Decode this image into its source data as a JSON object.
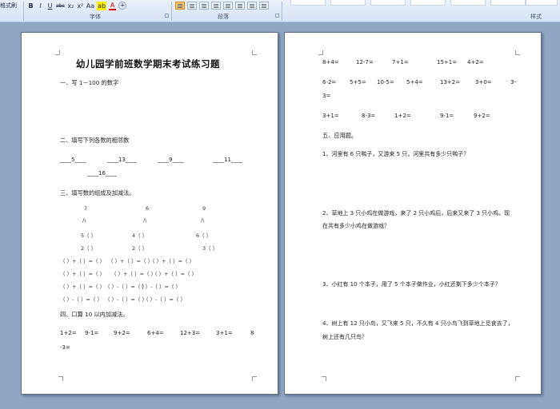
{
  "ribbon": {
    "left_stub": "格式刷",
    "font_buttons": [
      "B",
      "I",
      "U",
      "abc",
      "x₂",
      "x²",
      "Aa"
    ],
    "highlight_label": "ab",
    "font_color_label": "A",
    "font_group_label": "字体",
    "paragraph_group_label": "段落",
    "styles_group_label": "样式",
    "colors": {
      "highlight": "#ffef00",
      "font_color": "#cc0000",
      "active_align": "#f7c46a"
    }
  },
  "page1": {
    "title": "幼儿园学前班数学期末考试练习题",
    "sections": {
      "s1": "一、写 1－100 的数字",
      "s2": "二、填写下列各数的相邻数",
      "s3": "三、填写数的组成及加减法。",
      "s4": "四、口算 10 以内加减法。"
    },
    "neighbors": [
      "____5____",
      "____13____",
      "____9____",
      "____11____",
      "____16____"
    ],
    "composition": {
      "tops": [
        "7",
        "6",
        "9"
      ],
      "branches": [
        "/\\",
        "/\\",
        "/\\"
      ],
      "row1": [
        "5（  ）",
        "4（  ）",
        "6（    ）"
      ],
      "row2": [
        "2（  ）",
        "2（  ）",
        "3（    ）"
      ]
    },
    "equations": [
      [
        "（   ）+（ ）=（ ）",
        "（ ）+（ ）=（ ）",
        "（ ）+（ ）=（ ）"
      ],
      [
        "（ ）+（ ）=（      ）",
        "（ ）+（ ）=（ ）",
        "（ ）+（ ）=（ ）"
      ],
      [
        "（ ）+（ ）=（    ）",
        "（ ）-（ ）=（ ）",
        "（ ）-（ ）=（ ）"
      ],
      [
        "（ ）-（ ）=（ ）",
        "（ ）-（ ）=（ ）",
        "（ ）-（ ）=（ ）"
      ]
    ],
    "mental_math": [
      "1+2=",
      "9-1=",
      "9+2=",
      "6+4=",
      "12+3=",
      "3+1=",
      "8"
    ],
    "mental_math_wrap": "-3="
  },
  "page2": {
    "arithmetic": {
      "row1": [
        "8+4=",
        "12-7=",
        "7+1=",
        "15+1=",
        "4+2="
      ],
      "row2": [
        "6-2=",
        "5+5=",
        "10-5=",
        "5+4=",
        "13+2=",
        "3+0=",
        "3-"
      ],
      "row2_wrap": "3=",
      "row3": [
        "3+1=",
        "8-3=",
        "1+2=",
        "9-1=",
        "9+2="
      ]
    },
    "section5": "五、应用题。",
    "problems": [
      "1、河里有 6 只鸭子，又游来 5 只，河里共有多少只鸭子？",
      "2、草地上 3 只小鸡在做游戏，来了 2 只小鸡后，后来又来了 3 只小鸡，现",
      "在共有多少小鸡在做游戏？",
      "3、小红有 10 个本子，用了 5 个本子做作业，小红还剩下多少个本子？",
      "4、树上有 12 只小鸟，又飞来 5 只，不久有 4 只小鸟飞到草地上觅食去了，",
      "树上还有几只鸟？"
    ]
  }
}
